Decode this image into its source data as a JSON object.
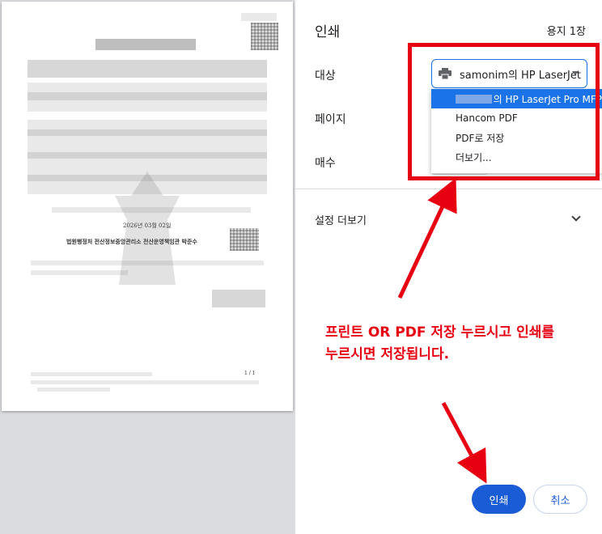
{
  "dialog": {
    "title": "인쇄",
    "sheet_count": "용지 1장"
  },
  "destination": {
    "label": "대상",
    "selected": "samonim의 HP LaserJet",
    "options": [
      {
        "label": "의 HP LaserJet Pro MFP",
        "selected": true
      },
      {
        "label": "Hancom PDF",
        "selected": false
      },
      {
        "label": "PDF로 저장",
        "selected": false
      },
      {
        "label": "더보기...",
        "selected": false
      }
    ]
  },
  "pages": {
    "label": "페이지"
  },
  "copies": {
    "label": "매수"
  },
  "more_settings": {
    "label": "설정 더보기"
  },
  "buttons": {
    "print": "인쇄",
    "cancel": "취소"
  },
  "annotation": {
    "line1": "프린트 OR PDF 저장 누르시고 인쇄를",
    "line2": "누르시면 저장됩니다."
  },
  "document": {
    "date_line": "2026년 03월 02일",
    "issuer": "법원행정처 전산정보중앙관리소 전산운영책임관 박준수",
    "footer_page": "1 / 1"
  },
  "colors": {
    "accent": "#1a73e8",
    "annotation_red": "#e60012",
    "preview_bg": "#dadce0"
  }
}
